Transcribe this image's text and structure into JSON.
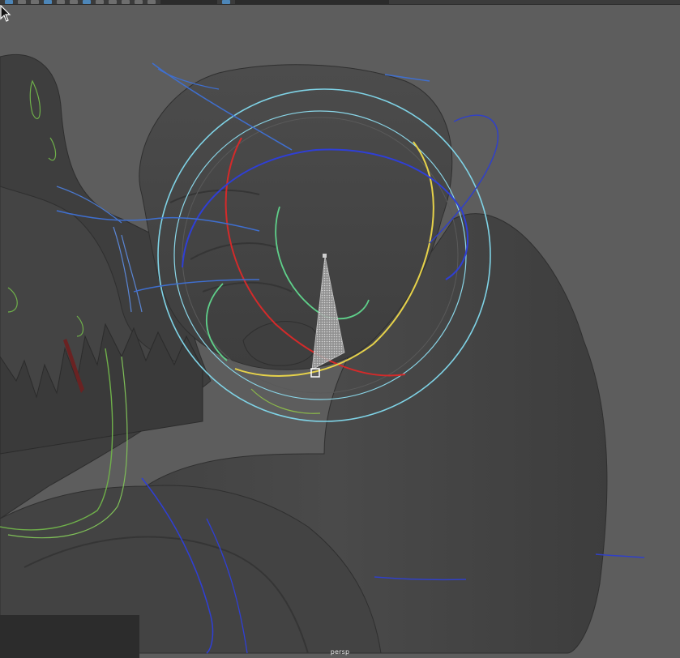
{
  "toolbar": {
    "buttons": [
      "select-tool",
      "lasso-tool",
      "paint-tool",
      "move-tool",
      "rotate-tool",
      "scale-tool",
      "snap-grid",
      "snap-curve",
      "snap-point",
      "render",
      "ipr",
      "render-settings"
    ],
    "active_button": "select-tool"
  },
  "viewport": {
    "camera_label": "persp",
    "background_color": "#5d5d5d",
    "mesh_color": "#474747",
    "controls": {
      "fk_circle_color": "#7fd3e6",
      "rotate_x_color": "#d42a2a",
      "rotate_y_color": "#e6d24a",
      "rotate_z_color": "#2f3fd6",
      "nurbs_blue_color": "#3f6fd0",
      "nurbs_green_color": "#6fb04a"
    }
  },
  "icons": {
    "cursor": "mouse-pointer-icon",
    "pivot": "pivot-handle-icon"
  }
}
